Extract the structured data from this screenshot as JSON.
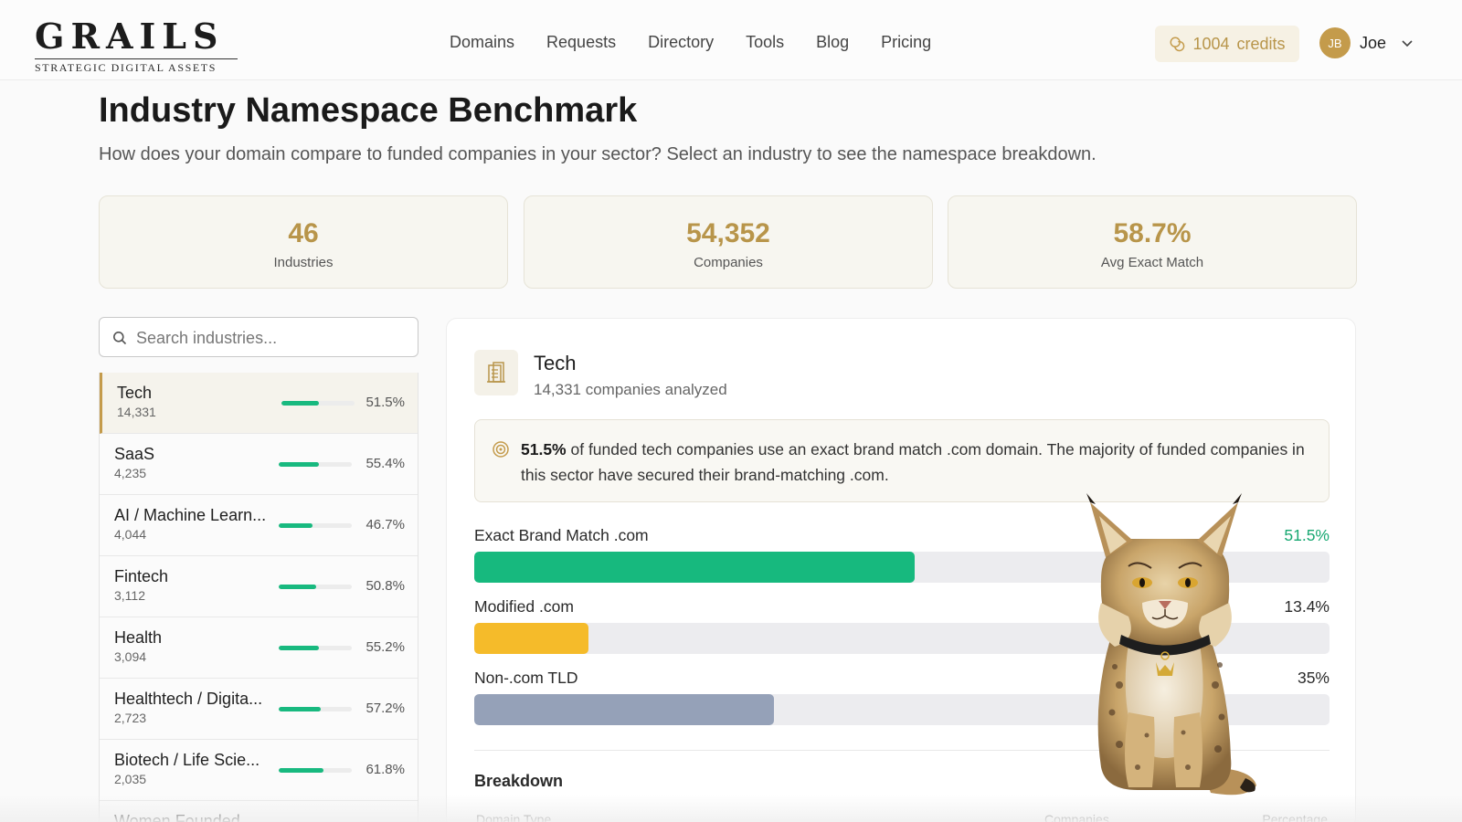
{
  "header": {
    "logo_main": "GRAILS",
    "logo_sub": "STRATEGIC DIGITAL ASSETS",
    "nav": [
      "Domains",
      "Requests",
      "Directory",
      "Tools",
      "Blog",
      "Pricing"
    ],
    "credits_value": "1004",
    "credits_label": "credits",
    "user_initials": "JB",
    "user_name": "Joe"
  },
  "page": {
    "title": "Industry Namespace Benchmark",
    "subtitle": "How does your domain compare to funded companies in your sector? Select an industry to see the namespace breakdown."
  },
  "stats": [
    {
      "value": "46",
      "label": "Industries"
    },
    {
      "value": "54,352",
      "label": "Companies"
    },
    {
      "value": "58.7%",
      "label": "Avg Exact Match"
    }
  ],
  "search": {
    "placeholder": "Search industries..."
  },
  "industries": [
    {
      "name": "Tech",
      "count": "14,331",
      "pct": "51.5%",
      "value": 51.5,
      "active": true
    },
    {
      "name": "SaaS",
      "count": "4,235",
      "pct": "55.4%",
      "value": 55.4
    },
    {
      "name": "AI / Machine Learn...",
      "count": "4,044",
      "pct": "46.7%",
      "value": 46.7
    },
    {
      "name": "Fintech",
      "count": "3,112",
      "pct": "50.8%",
      "value": 50.8
    },
    {
      "name": "Health",
      "count": "3,094",
      "pct": "55.2%",
      "value": 55.2
    },
    {
      "name": "Healthtech / Digita...",
      "count": "2,723",
      "pct": "57.2%",
      "value": 57.2
    },
    {
      "name": "Biotech / Life Scie...",
      "count": "2,035",
      "pct": "61.8%",
      "value": 61.8
    },
    {
      "name": "Women Founded",
      "count": "",
      "pct": "",
      "value": 0
    }
  ],
  "detail": {
    "title": "Tech",
    "subtitle": "14,331 companies analyzed",
    "insight_bold": "51.5%",
    "insight_rest": " of funded tech companies use an exact brand match .com domain. The majority of funded companies in this sector have secured their brand-matching .com.",
    "metrics": [
      {
        "label": "Exact Brand Match .com",
        "pct": "51.5%",
        "value": 51.5,
        "color": "#17b97e"
      },
      {
        "label": "Modified .com",
        "pct": "13.4%",
        "value": 13.4,
        "color": "#f5bb2a"
      },
      {
        "label": "Non-.com TLD",
        "pct": "35%",
        "value": 35,
        "color": "#95a1b8"
      }
    ],
    "breakdown_title": "Breakdown",
    "columns": [
      "Domain Type",
      "Companies",
      "Percentage"
    ]
  },
  "colors": {
    "accent": "#c49b4b",
    "green": "#18b97f"
  }
}
